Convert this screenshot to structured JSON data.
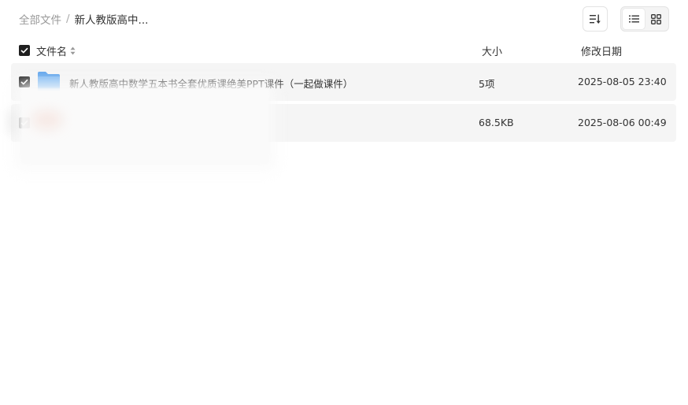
{
  "breadcrumb": {
    "root": "全部文件",
    "separator": "/",
    "current": "新人教版高中..."
  },
  "toolbar": {
    "sort_icon": "sort-lines-icon",
    "views": [
      {
        "icon": "list-view-icon",
        "active": true
      },
      {
        "icon": "grid-view-icon",
        "active": false
      }
    ]
  },
  "list_header": {
    "name": "文件名",
    "size": "大小",
    "date": "修改日期"
  },
  "rows": [
    {
      "icon": "folder-icon",
      "name": "新人教版高中数学五本书全套优质课绝美PPT课件（一起做课件）",
      "size": "5项",
      "date": "2025-08-05 23:40",
      "checked": true
    },
    {
      "icon": "file-icon",
      "name": "",
      "size": "68.5KB",
      "date": "2025-08-06 00:49",
      "checked": true
    }
  ],
  "colors": {
    "row_bg": "#f5f5f5",
    "folder": "#6aaef0",
    "checkbox": "#1f1f1f"
  }
}
